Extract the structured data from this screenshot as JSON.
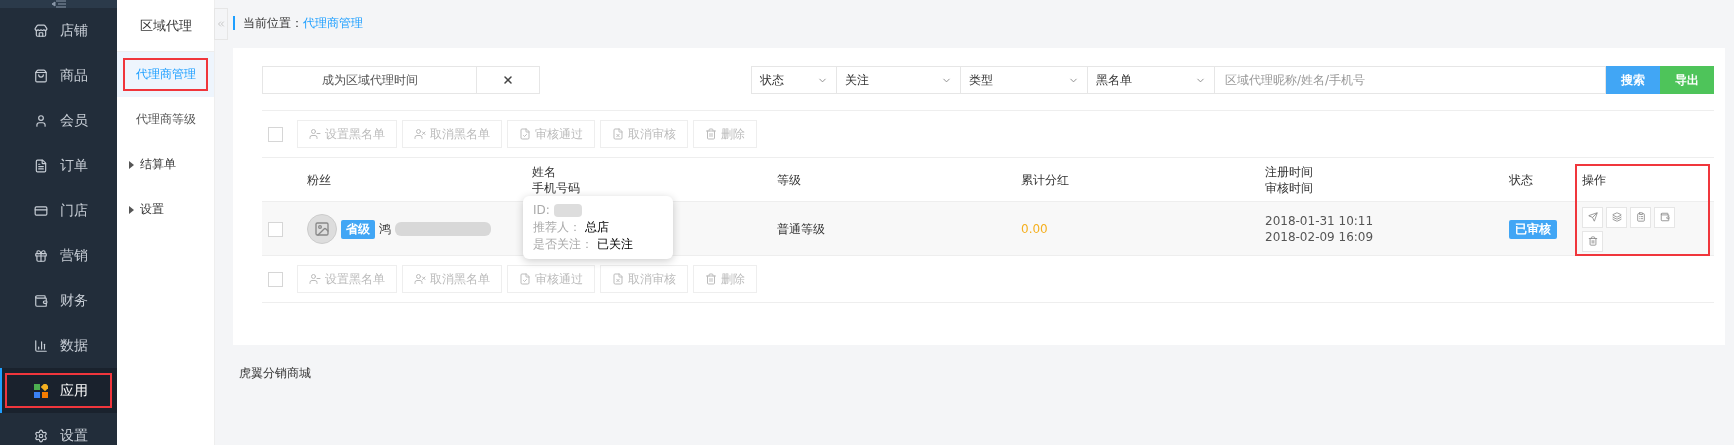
{
  "sidebar": {
    "items": [
      {
        "label": "店铺",
        "selected": false,
        "highlighted": false
      },
      {
        "label": "商品",
        "selected": false,
        "highlighted": false
      },
      {
        "label": "会员",
        "selected": false,
        "highlighted": false
      },
      {
        "label": "订单",
        "selected": false,
        "highlighted": false
      },
      {
        "label": "门店",
        "selected": false,
        "highlighted": false
      },
      {
        "label": "营销",
        "selected": false,
        "highlighted": false
      },
      {
        "label": "财务",
        "selected": false,
        "highlighted": false
      },
      {
        "label": "数据",
        "selected": false,
        "highlighted": false
      },
      {
        "label": "应用",
        "selected": true,
        "highlighted": true
      },
      {
        "label": "设置",
        "selected": false,
        "highlighted": false
      }
    ]
  },
  "submenu": {
    "title": "区域代理",
    "items": [
      {
        "kind": "link",
        "label": "代理商管理",
        "selected": true,
        "highlighted": true
      },
      {
        "kind": "link",
        "label": "代理商等级",
        "selected": false,
        "highlighted": false
      },
      {
        "kind": "group",
        "label": "结算单",
        "expanded": false
      },
      {
        "kind": "group",
        "label": "设置",
        "expanded": false
      }
    ]
  },
  "breadcrumb": {
    "label": "当前位置：",
    "current": "代理商管理"
  },
  "filters": {
    "date_field": {
      "placeholder": "成为区域代理时间"
    },
    "selects": [
      {
        "value": "状态"
      },
      {
        "value": "关注"
      },
      {
        "value": "类型"
      },
      {
        "value": "黑名单"
      }
    ],
    "search": {
      "placeholder": "区域代理昵称/姓名/手机号"
    },
    "buttons": [
      {
        "kind": "primary",
        "label": "搜索"
      },
      {
        "kind": "success",
        "label": "导出"
      }
    ]
  },
  "bulk_actions_top": {
    "checked": false,
    "buttons": [
      "设置黑名单",
      "取消黑名单",
      "审核通过",
      "取消审核",
      "删除"
    ]
  },
  "table": {
    "columns": [
      {
        "lines": [
          "粉丝"
        ],
        "highlighted": false
      },
      {
        "lines": [
          "姓名",
          "手机号码"
        ],
        "highlighted": false
      },
      {
        "lines": [
          "等级"
        ],
        "highlighted": false
      },
      {
        "lines": [
          "累计分红"
        ],
        "highlighted": false
      },
      {
        "lines": [
          "注册时间",
          "审核时间"
        ],
        "highlighted": false
      },
      {
        "lines": [
          "状态"
        ],
        "highlighted": false
      },
      {
        "lines": [
          "操作"
        ],
        "highlighted": true
      }
    ],
    "rows": [
      {
        "checked": false,
        "level_badge": "省级",
        "name": "鸿",
        "grade": "普通等级",
        "dividend": "0.00",
        "registered": "2018-01-31 10:11",
        "reviewed": "2018-02-09 16:09",
        "status": "已审核"
      }
    ]
  },
  "tooltip": {
    "id_label": "ID:",
    "referrer_label": "推荐人：",
    "referrer": "总店",
    "follow_label": "是否关注：",
    "follow": "已关注"
  },
  "bulk_actions_bottom": {
    "checked": false,
    "buttons": [
      "设置黑名单",
      "取消黑名单",
      "审核通过",
      "取消审核",
      "删除"
    ]
  },
  "footer": "虎翼分销商城"
}
